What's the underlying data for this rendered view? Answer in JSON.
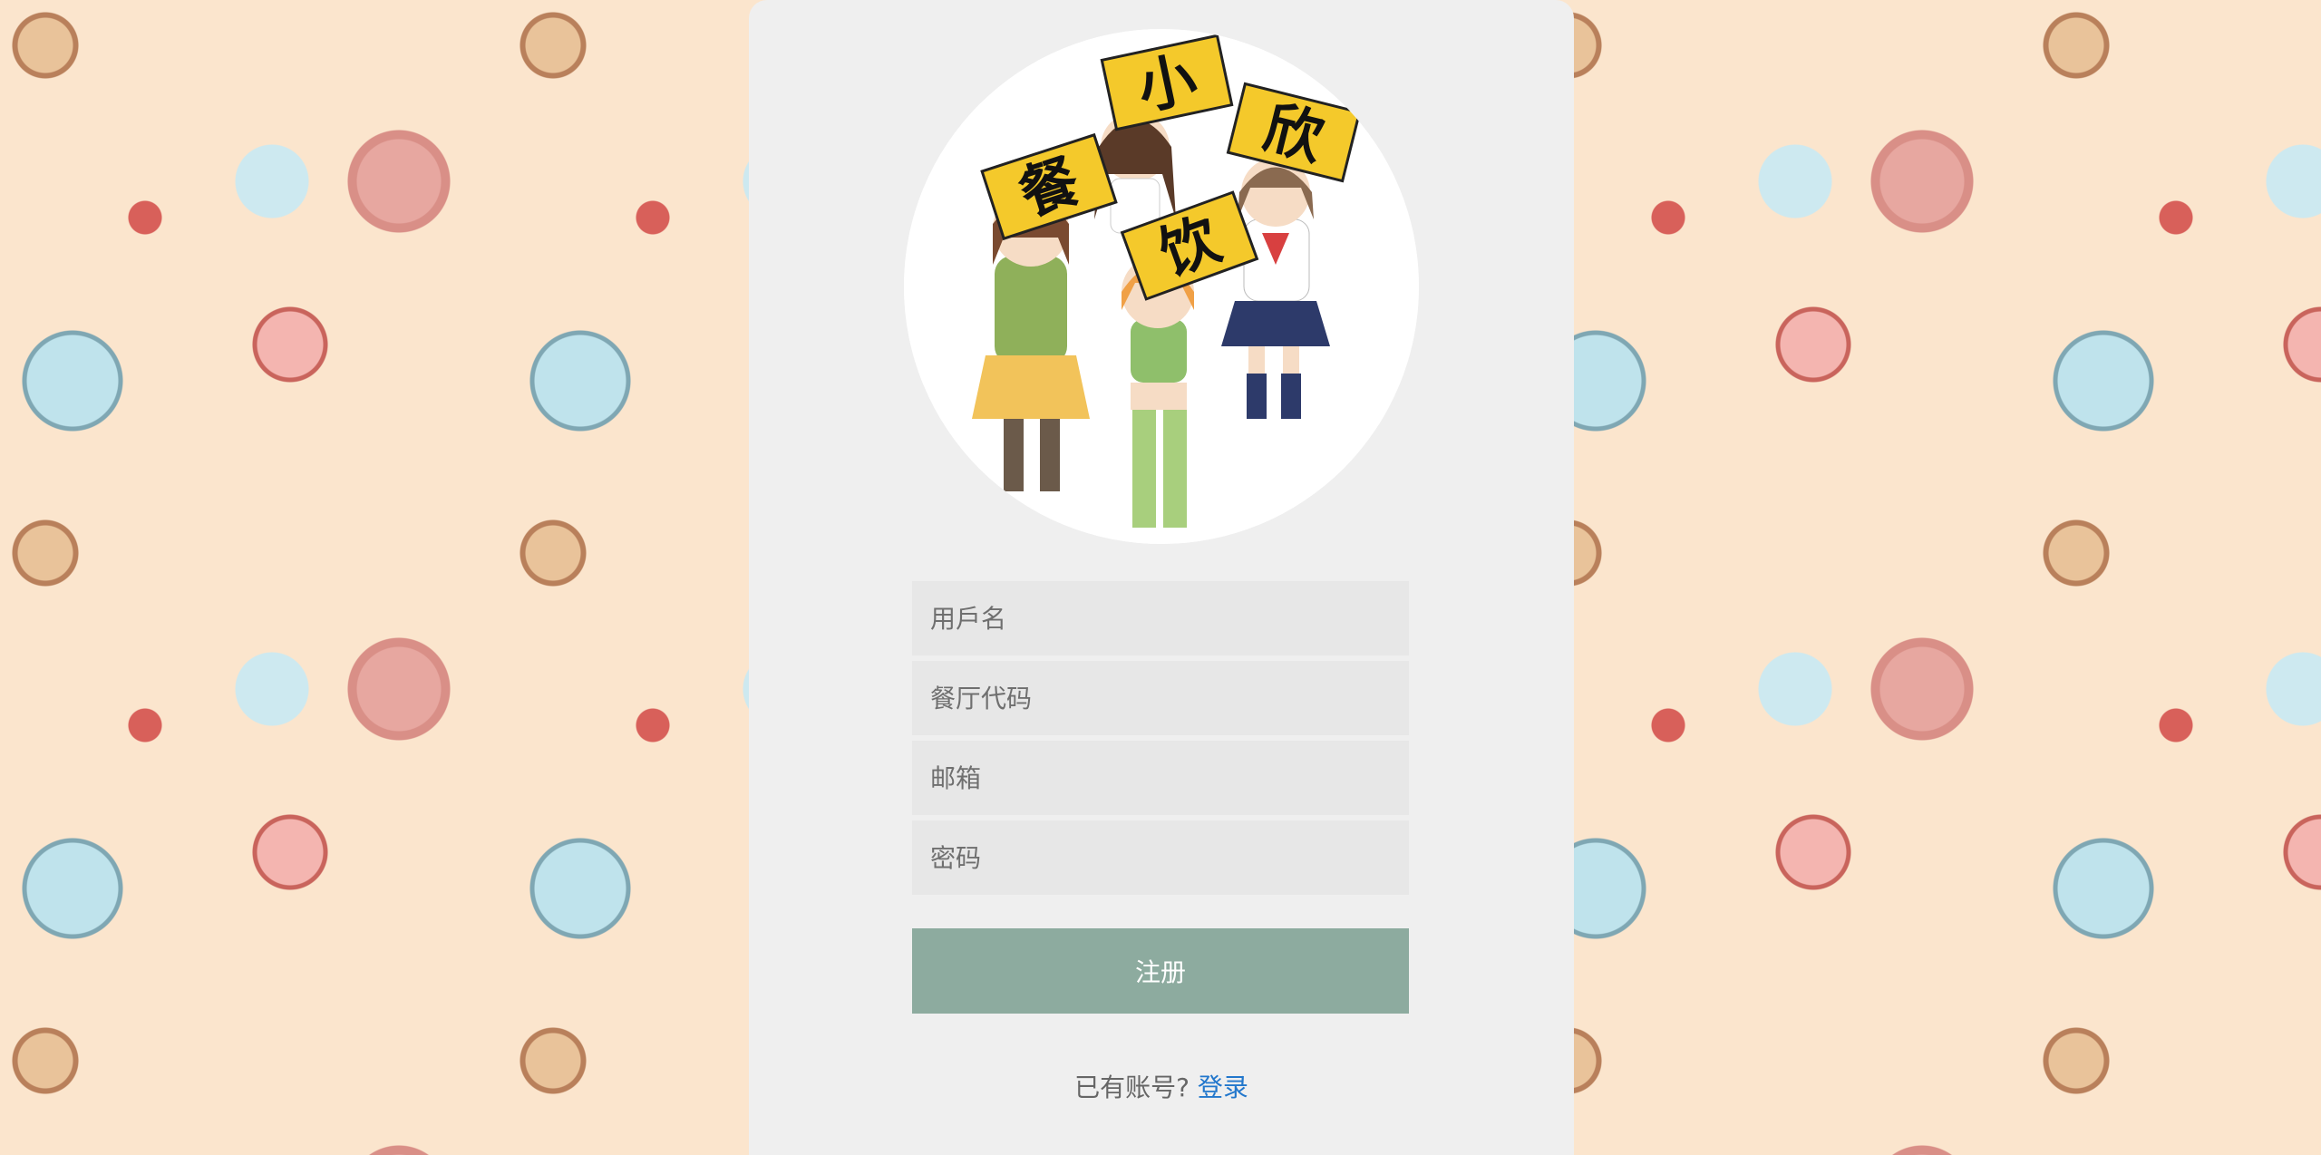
{
  "colors": {
    "card_bg": "#efefef",
    "field_bg": "#e7e7e7",
    "button_bg": "#8dab9f",
    "link": "#2277cc"
  },
  "logo": {
    "sign_chars": [
      "小",
      "欣",
      "餐",
      "饮"
    ]
  },
  "form": {
    "username_placeholder": "用戶名",
    "restaurant_code_placeholder": "餐厅代码",
    "email_placeholder": "邮箱",
    "password_placeholder": "密码",
    "submit_label": "注册"
  },
  "footer": {
    "prompt": "已有账号?",
    "login_link": "登录"
  }
}
